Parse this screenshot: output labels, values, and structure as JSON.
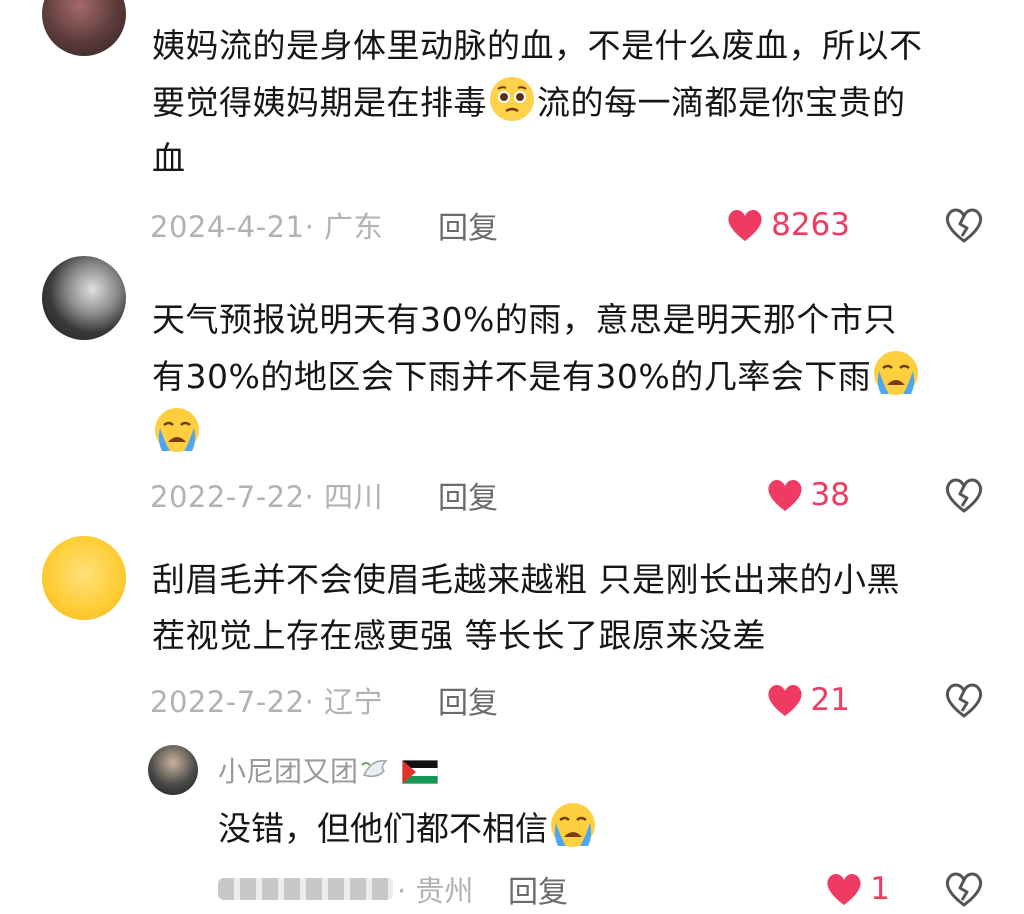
{
  "comments": [
    {
      "text_lines": [
        "姨妈流的是身体里动脉的血，不是什么废血，所以不",
        "要觉得姨妈期是在排毒",
        "流的每一滴都是你宝贵的",
        "血"
      ],
      "time_location": "2024-4-21· 广东",
      "reply_label": "回复",
      "likes": "8263"
    },
    {
      "text_lines": [
        "天气预报说明天有30%的雨，意思是明天那个市只",
        "有30%的地区会下雨并不是有30%的几率会下雨"
      ],
      "time_location": "2022-7-22· 四川",
      "reply_label": "回复",
      "likes": "38"
    },
    {
      "text_lines": [
        "刮眉毛并不会使眉毛越来越粗 只是刚长出来的小黑",
        "茬视觉上存在感更强 等长长了跟原来没差"
      ],
      "time_location": "2022-7-22· 辽宁",
      "reply_label": "回复",
      "likes": "21"
    }
  ],
  "reply": {
    "username": "小尼团又团",
    "text": "没错，但他们都不相信",
    "location": "· 贵州",
    "reply_label": "回复",
    "likes": "1"
  },
  "colors": {
    "like": "#ef3b61",
    "meta": "#b2b2b2",
    "text": "#161616"
  },
  "icons": [
    "heart-icon",
    "broken-heart-icon",
    "pleading-face-emoji",
    "crying-face-emoji",
    "dove-emoji",
    "palestine-flag-emoji"
  ]
}
